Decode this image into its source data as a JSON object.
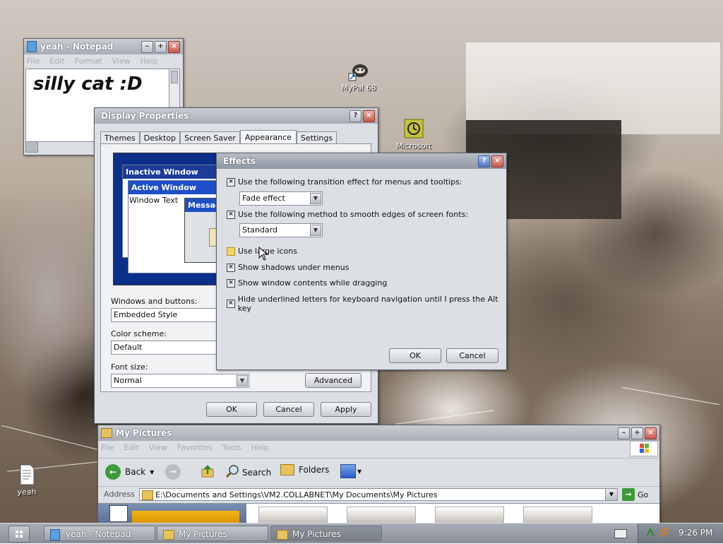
{
  "desktop": {
    "icons": [
      {
        "label": "MyPal 68"
      },
      {
        "label": "Microsoft"
      },
      {
        "label": "yeah"
      }
    ]
  },
  "notepad": {
    "title": "yeah - Notepad",
    "menu": [
      "File",
      "Edit",
      "Format",
      "View",
      "Help"
    ],
    "content": "silly cat :D"
  },
  "display_properties": {
    "title": "Display Properties",
    "tabs": [
      "Themes",
      "Desktop",
      "Screen Saver",
      "Appearance",
      "Settings"
    ],
    "active_tab": "Appearance",
    "preview": {
      "inactive_title": "Inactive Window",
      "active_title": "Active Window",
      "window_text": "Window Text",
      "message_box": "Message"
    },
    "windows_and_buttons_label": "Windows and buttons:",
    "windows_and_buttons_value": "Embedded Style",
    "color_scheme_label": "Color scheme:",
    "color_scheme_value": "Default",
    "font_size_label": "Font size:",
    "font_size_value": "Normal",
    "advanced_label": "Advanced",
    "ok_label": "OK",
    "cancel_label": "Cancel",
    "apply_label": "Apply"
  },
  "effects": {
    "title": "Effects",
    "options": [
      {
        "label": "Use the following transition effect for menus and tooltips:",
        "checked": true
      },
      {
        "label": "Use the following method to smooth edges of screen fonts:",
        "checked": true
      },
      {
        "label": "Use large icons",
        "checked": false
      },
      {
        "label": "Show shadows under menus",
        "checked": true
      },
      {
        "label": "Show window contents while dragging",
        "checked": true
      },
      {
        "label": "Hide underlined letters for keyboard navigation until I press the Alt key",
        "checked": true
      }
    ],
    "transition_value": "Fade effect",
    "smoothing_value": "Standard",
    "ok_label": "OK",
    "cancel_label": "Cancel"
  },
  "explorer": {
    "title": "My Pictures",
    "menu": [
      "File",
      "Edit",
      "View",
      "Favorites",
      "Tools",
      "Help"
    ],
    "back_label": "Back",
    "search_label": "Search",
    "folders_label": "Folders",
    "address_label": "Address",
    "address_value": "E:\\Documents and Settings\\VM2.COLLABNET\\My Documents\\My Pictures",
    "go_label": "Go"
  },
  "taskbar": {
    "items": [
      "yeah - Notepad",
      "My Pictures",
      "My Pictures"
    ],
    "clock": "9:26 PM"
  },
  "colors": {
    "titlebar": "#a9aeb6",
    "window_bg": "#dcdfe4",
    "preview_blue": "#0a2a86",
    "highlight_check": "#f5d36a",
    "go_green": "#3c9a3c"
  }
}
